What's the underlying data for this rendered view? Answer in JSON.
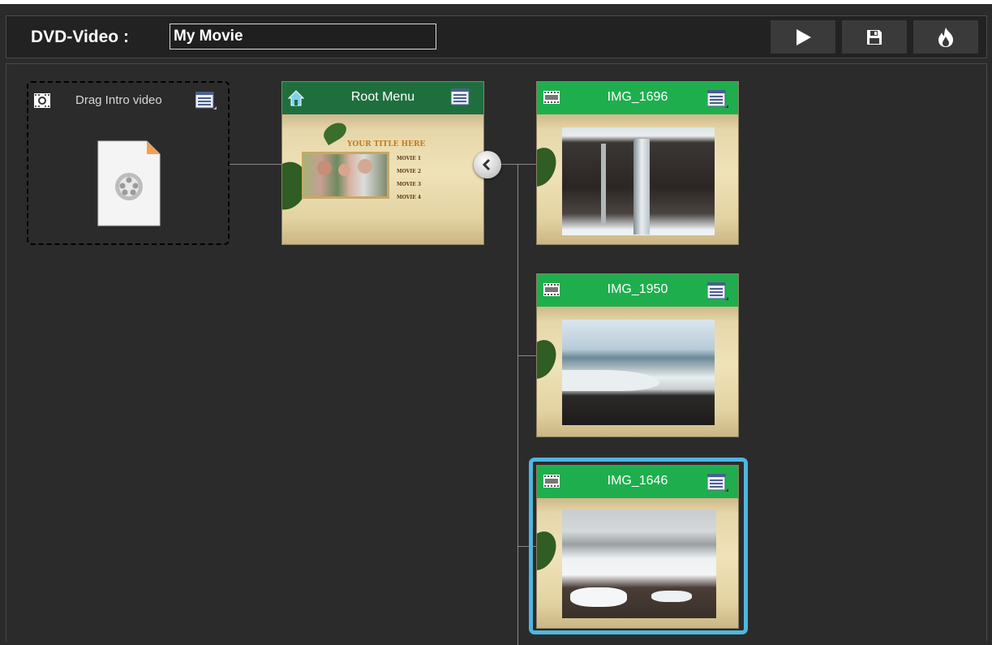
{
  "header": {
    "label": "DVD-Video :",
    "title_value": "My Movie"
  },
  "toolbar": {
    "buttons": [
      {
        "icon": "play-icon"
      },
      {
        "icon": "save-icon"
      },
      {
        "icon": "burn-icon"
      }
    ]
  },
  "intro": {
    "label": "Drag Intro video",
    "icon": "video-file-icon"
  },
  "root_menu": {
    "title": "Root Menu",
    "preview_title": "YOUR TITLE HERE",
    "preview_items": [
      "MOVIE 1",
      "MOVIE 2",
      "MOVIE 3",
      "MOVIE 4"
    ]
  },
  "titles": [
    {
      "name": "IMG_1696",
      "selected": false
    },
    {
      "name": "IMG_1950",
      "selected": false
    },
    {
      "name": "IMG_1646",
      "selected": true
    }
  ],
  "colors": {
    "background": "#2b2b2b",
    "header_bg": "#222222",
    "root_header": "#1f6f3e",
    "title_header": "#1fae4e",
    "selection": "#4fb6e2"
  }
}
